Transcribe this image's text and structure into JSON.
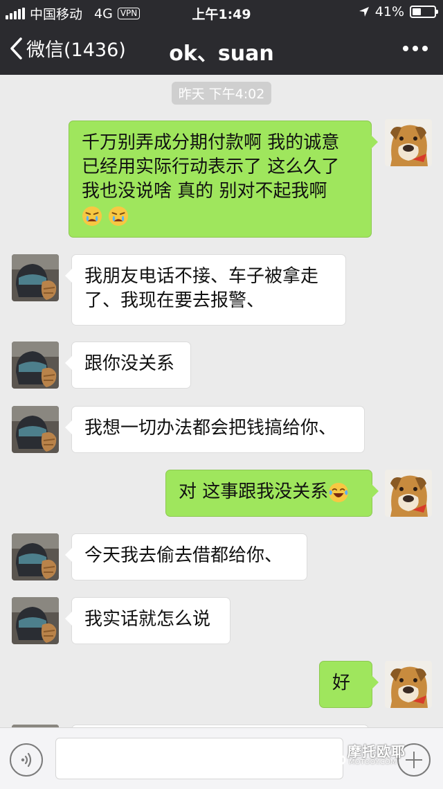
{
  "status_bar": {
    "carrier": "中国移动",
    "network": "4G",
    "vpn": "VPN",
    "time": "上午1:49",
    "battery": "41%",
    "battery_level": 0.41
  },
  "nav": {
    "back_label": "微信(1436)",
    "title": "ok、suan"
  },
  "chat": {
    "timestamp": "昨天 下午4:02",
    "messages": [
      {
        "direction": "out",
        "lines": [
          "千万别弄成分期付款啊  我的诚意",
          "已经用实际行动表示了 这么久了",
          "我也没说啥 真的 别对不起我啊"
        ],
        "emoji": [
          "crying-angry-emoji",
          "crying-angry-emoji"
        ]
      },
      {
        "direction": "in",
        "lines": [
          "我朋友电话不接、车子被拿走",
          "了、我现在要去报警、"
        ]
      },
      {
        "direction": "in",
        "lines": [
          "跟你没关系"
        ]
      },
      {
        "direction": "in",
        "lines": [
          "我想一切办法都会把钱搞给你、"
        ]
      },
      {
        "direction": "out",
        "lines": [
          "对 这事跟我没关系"
        ],
        "emoji": [
          "tears-of-joy-emoji"
        ]
      },
      {
        "direction": "in",
        "lines": [
          "今天我去偷去借都给你、"
        ]
      },
      {
        "direction": "in",
        "lines": [
          "我实话就怎么说"
        ]
      },
      {
        "direction": "out",
        "lines": [
          "好"
        ]
      }
    ]
  },
  "watermark": {
    "main": "摩托欧耶",
    "sub": "MOTOOY.COM"
  },
  "colors": {
    "bar_bg": "#2b2b2f",
    "chat_bg": "#ebebeb",
    "bubble_out": "#9fe65d",
    "bubble_in": "#ffffff"
  }
}
